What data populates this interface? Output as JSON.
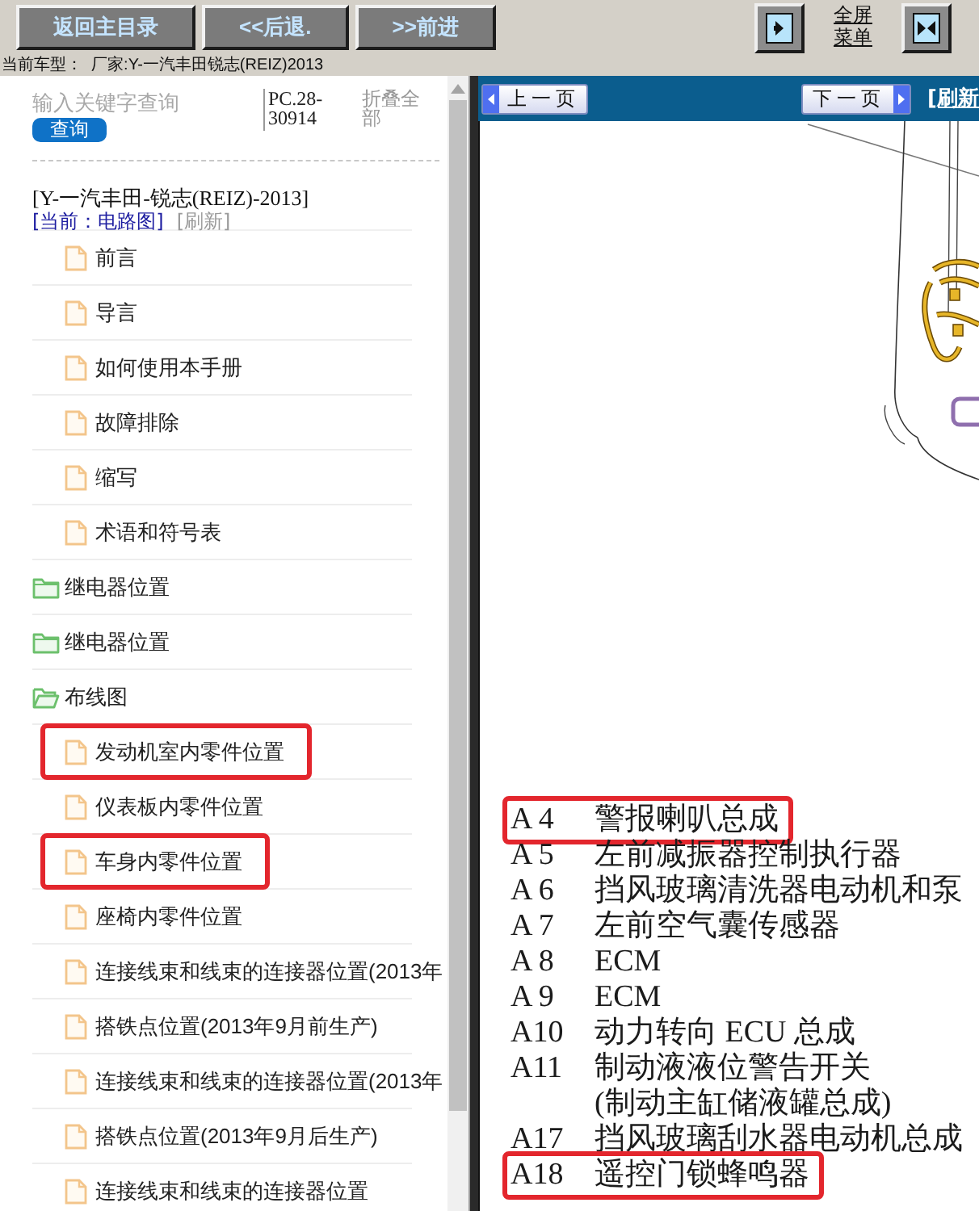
{
  "toolbar": {
    "buttons": [
      {
        "label": "返回主目录"
      },
      {
        "label": "<<后退."
      },
      {
        "label": ">>前进"
      }
    ],
    "tools": [
      {
        "kind": "panel-toggle"
      },
      {
        "kind": "link",
        "label": "全屏菜单"
      },
      {
        "kind": "split-toggle"
      }
    ]
  },
  "current_model": "当前车型：  厂家:Y-一汽丰田锐志(REIZ)2013",
  "sidebar": {
    "search": {
      "placeholder": "输入关键字查询",
      "button": "查询"
    },
    "part_number": "PC.28-30914",
    "collapse_all": "折叠全部",
    "title": "[Y-一汽丰田-锐志(REIZ)-2013]",
    "current": "[当前：电路图]",
    "refresh": "[刷新]",
    "tree": [
      {
        "kind": "folder",
        "children": [
          {
            "kind": "file",
            "label": "前言",
            "highlighted": false
          },
          {
            "kind": "file",
            "label": "导言",
            "highlighted": false
          },
          {
            "kind": "file",
            "label": "如何使用本手册",
            "highlighted": false
          },
          {
            "kind": "file",
            "label": "故障排除",
            "highlighted": false
          },
          {
            "kind": "file",
            "label": "缩写",
            "highlighted": false
          },
          {
            "kind": "file",
            "label": "术语和符号表",
            "highlighted": false
          }
        ]
      },
      {
        "kind": "folder",
        "label": "继电器位置",
        "expanded": false
      },
      {
        "kind": "folder",
        "label": "继电器位置",
        "expanded": false
      },
      {
        "kind": "folder",
        "label": "布线图",
        "expanded": true,
        "children": [
          {
            "kind": "file",
            "label": "发动机室内零件位置",
            "highlighted": true
          },
          {
            "kind": "file",
            "label": "仪表板内零件位置",
            "highlighted": false
          },
          {
            "kind": "file",
            "label": "车身内零件位置",
            "highlighted": true
          },
          {
            "kind": "file",
            "label": "座椅内零件位置",
            "highlighted": false
          },
          {
            "kind": "file",
            "label": "连接线束和线束的连接器位置(2013年",
            "highlighted": false
          },
          {
            "kind": "file",
            "label": "搭铁点位置(2013年9月前生产)",
            "highlighted": false
          },
          {
            "kind": "file",
            "label": "连接线束和线束的连接器位置(2013年",
            "highlighted": false
          },
          {
            "kind": "file",
            "label": "搭铁点位置(2013年9月后生产)",
            "highlighted": false
          },
          {
            "kind": "file",
            "label": "连接线束和线束的连接器位置",
            "highlighted": false
          }
        ]
      }
    ]
  },
  "viewer": {
    "prev_button": "上一页",
    "next_button": "下一页",
    "refresh_link": "[刷新",
    "legend": [
      {
        "code": "A 4",
        "name": "警报喇叭总成",
        "highlighted": true
      },
      {
        "code": "A 5",
        "name": "左前减振器控制执行器",
        "highlighted": false
      },
      {
        "code": "A 6",
        "name": "挡风玻璃清洗器电动机和泵",
        "highlighted": false
      },
      {
        "code": "A 7",
        "name": "左前空气囊传感器",
        "highlighted": false
      },
      {
        "code": "A 8",
        "name": "ECM",
        "highlighted": false
      },
      {
        "code": "A 9",
        "name": "ECM",
        "highlighted": false
      },
      {
        "code": "A10",
        "name": "动力转向 ECU 总成",
        "highlighted": false
      },
      {
        "code": "A11",
        "name": "制动液液位警告开关",
        "note": "(制动主缸储液罐总成)",
        "highlighted": false
      },
      {
        "code": "A17",
        "name": "挡风玻璃刮水器电动机总成",
        "highlighted": false
      },
      {
        "code": "A18",
        "name": "遥控门锁蜂鸣器",
        "highlighted": true
      }
    ]
  }
}
